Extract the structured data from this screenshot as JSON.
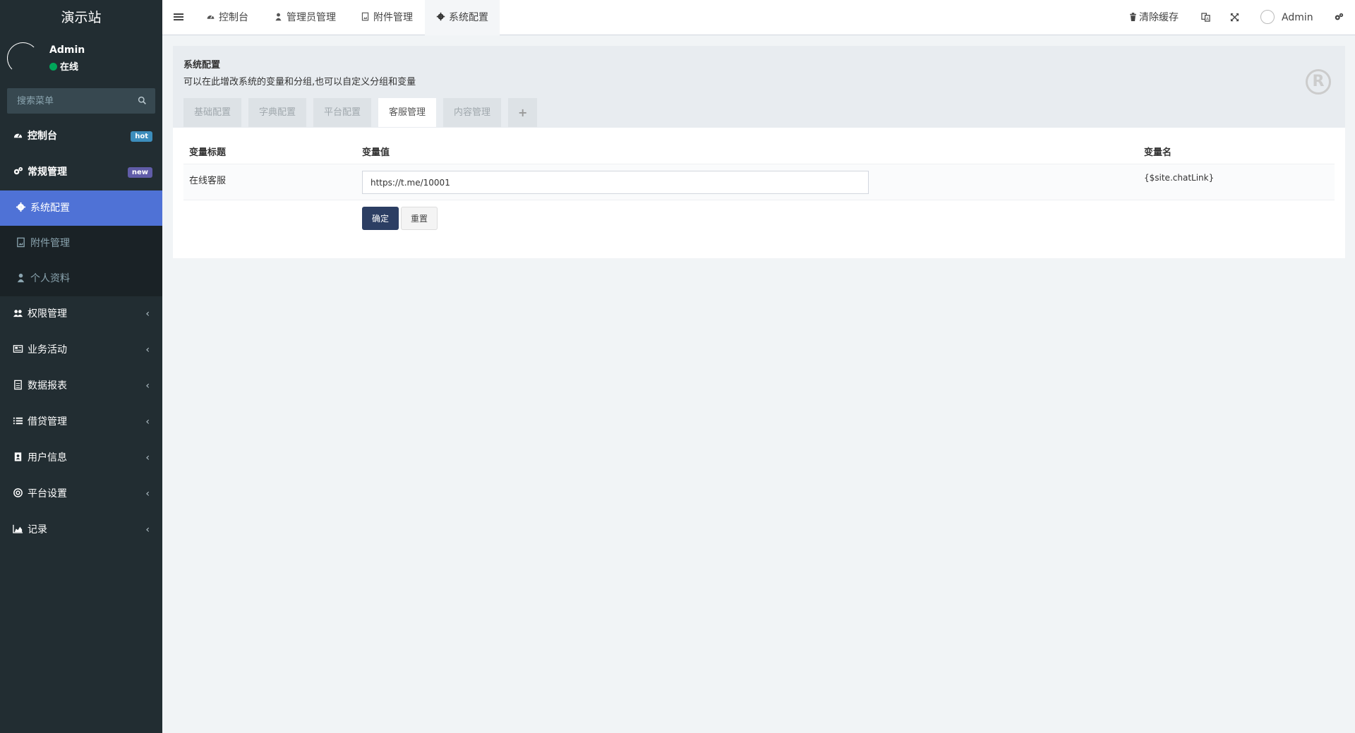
{
  "app": {
    "logo": "演示站"
  },
  "user": {
    "name": "Admin",
    "status": "在线"
  },
  "search": {
    "placeholder": "搜索菜单"
  },
  "sidebar": {
    "items": [
      {
        "label": "控制台",
        "icon": "dashboard-icon",
        "badge": "hot"
      },
      {
        "label": "常规管理",
        "icon": "cogs-icon",
        "badge": "new"
      },
      {
        "label": "系统配置",
        "icon": "gear-icon"
      },
      {
        "label": "附件管理",
        "icon": "file-image-icon"
      },
      {
        "label": "个人资料",
        "icon": "user-icon"
      },
      {
        "label": "权限管理",
        "icon": "users-icon"
      },
      {
        "label": "业务活动",
        "icon": "newspaper-icon"
      },
      {
        "label": "数据报表",
        "icon": "file-text-icon"
      },
      {
        "label": "借贷管理",
        "icon": "list-icon"
      },
      {
        "label": "用户信息",
        "icon": "address-book-icon"
      },
      {
        "label": "平台设置",
        "icon": "life-ring-icon"
      },
      {
        "label": "记录",
        "icon": "area-chart-icon"
      }
    ]
  },
  "header": {
    "tabs": [
      {
        "label": "控制台"
      },
      {
        "label": "管理员管理"
      },
      {
        "label": "附件管理"
      },
      {
        "label": "系统配置"
      }
    ],
    "clear_cache": "清除缓存",
    "user": "Admin"
  },
  "page": {
    "title": "系统配置",
    "description": "可以在此增改系统的变量和分组,也可以自定义分组和变量",
    "tabs": [
      "基础配置",
      "字典配置",
      "平台配置",
      "客服管理",
      "内容管理",
      "+"
    ],
    "columns": [
      "变量标题",
      "变量值",
      "变量名"
    ],
    "row": {
      "title": "在线客服",
      "value": "https://t.me/10001",
      "name": "{$site.chatLink}"
    },
    "buttons": {
      "ok": "确定",
      "reset": "重置"
    }
  },
  "colors": {
    "sidebar_bg": "#222d32",
    "active_menu": "#4f72d6",
    "primary_button": "#2c3e63"
  }
}
